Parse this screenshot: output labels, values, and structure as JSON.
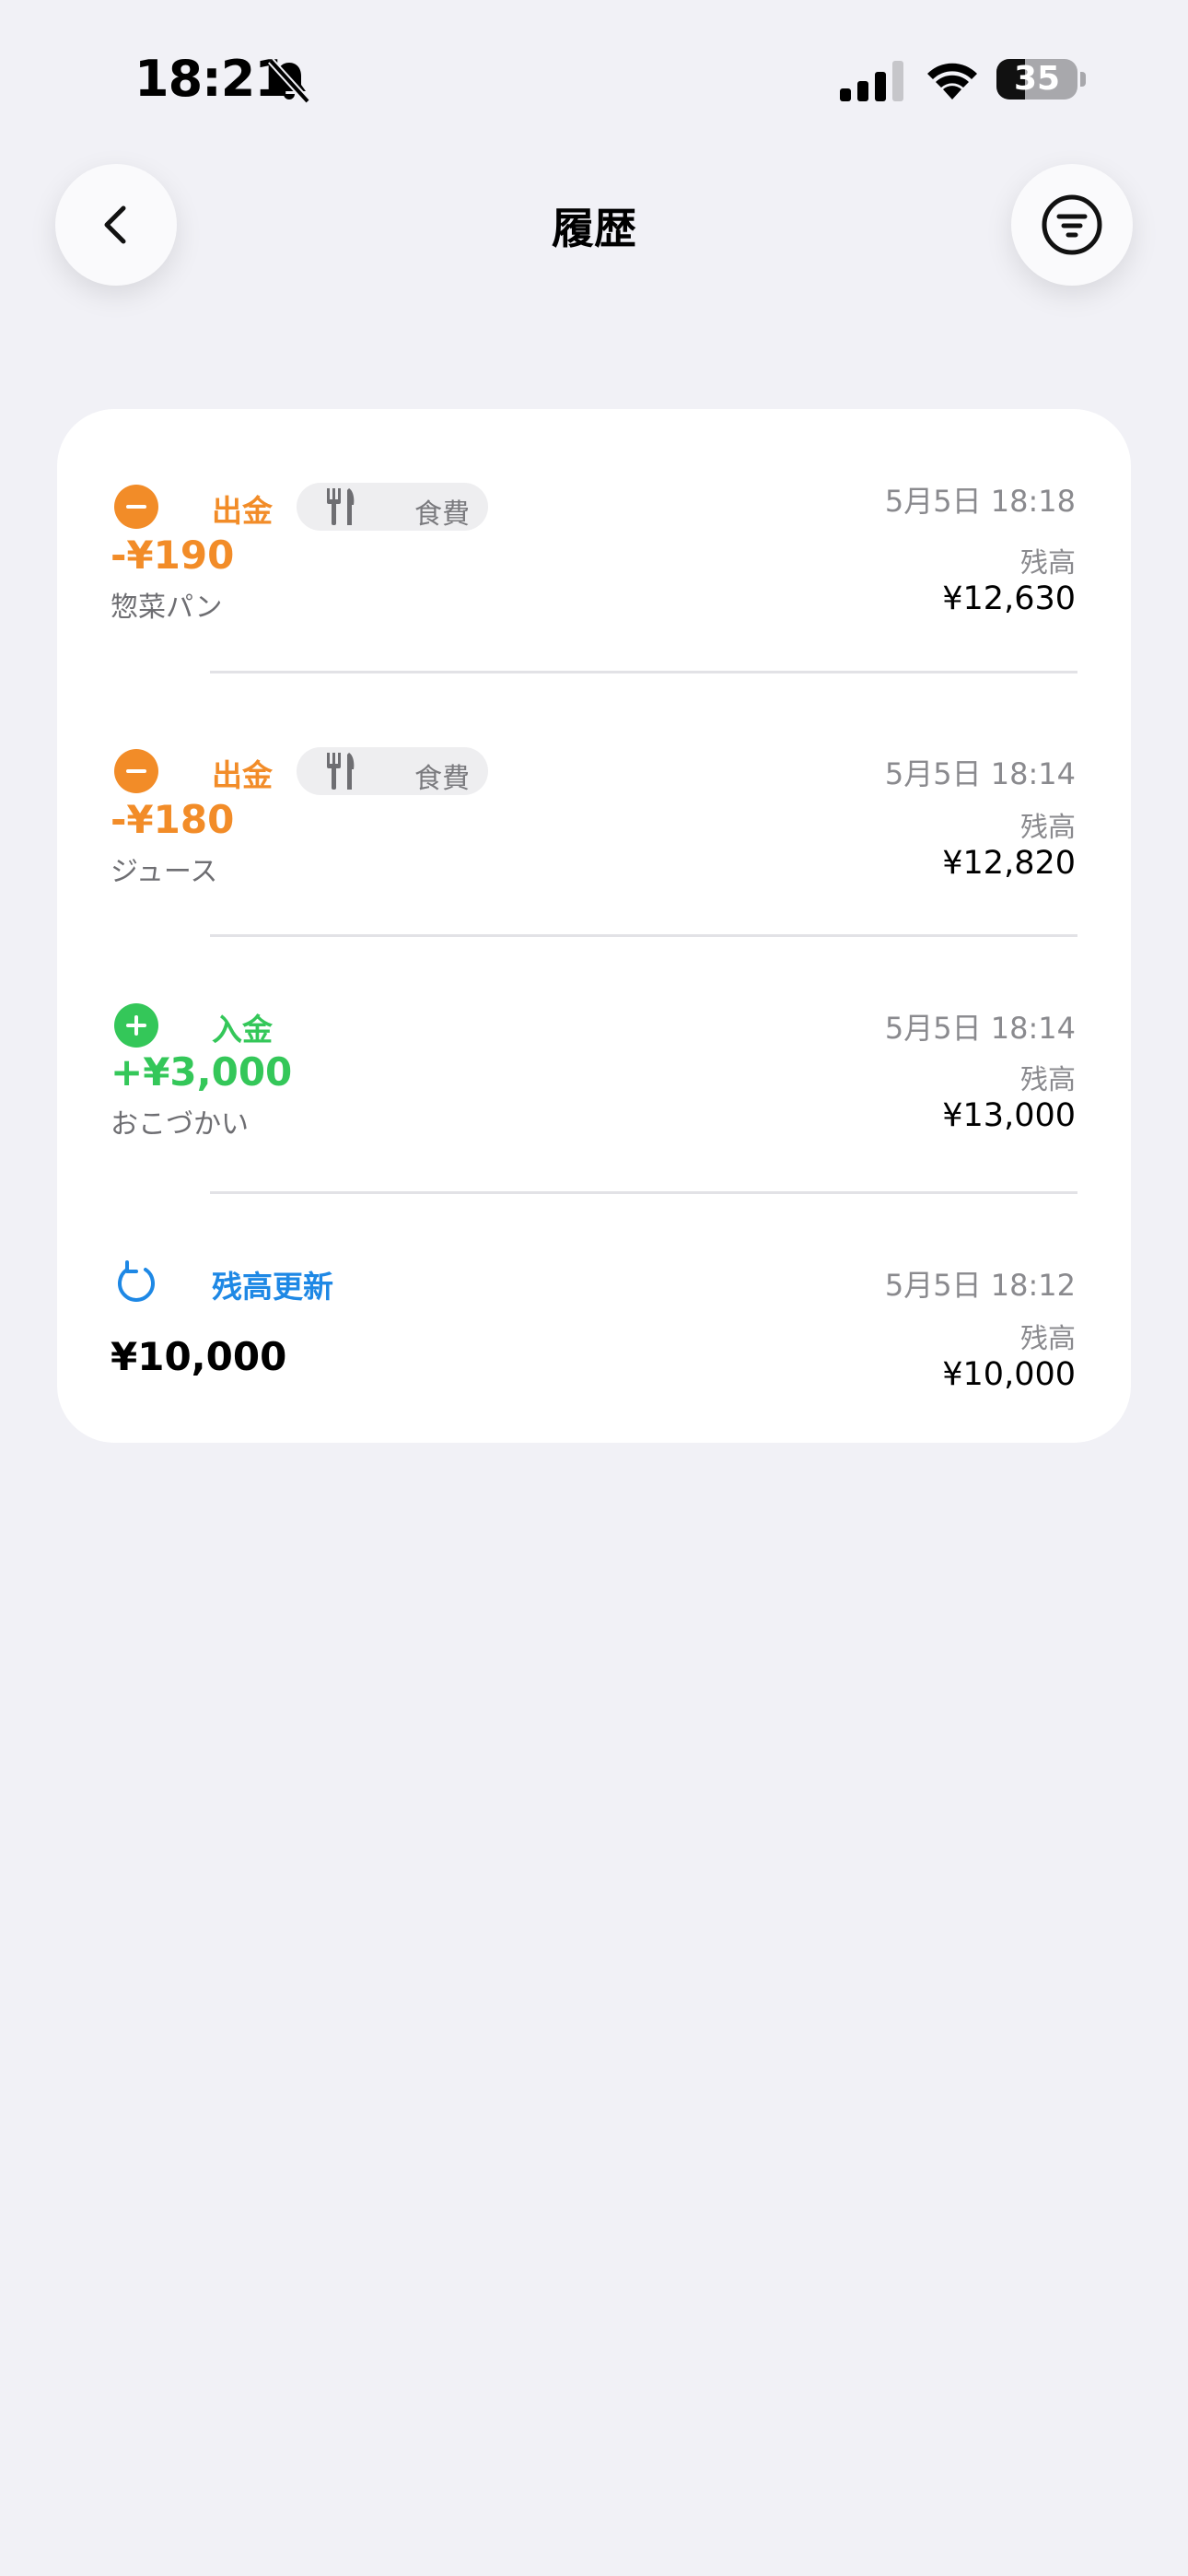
{
  "status_bar": {
    "time": "18:21",
    "battery": "35",
    "battery_level": 0.35
  },
  "nav": {
    "title": "履歴"
  },
  "entries": [
    {
      "type_label": "出金",
      "category": "食費",
      "date": "5月5日 18:18",
      "amount": "-¥190",
      "memo": "惣菜パン",
      "balance_label": "残高",
      "balance": "¥12,630"
    },
    {
      "type_label": "出金",
      "category": "食費",
      "date": "5月5日 18:14",
      "amount": "-¥180",
      "memo": "ジュース",
      "balance_label": "残高",
      "balance": "¥12,820"
    },
    {
      "type_label": "入金",
      "date": "5月5日 18:14",
      "amount": "+¥3,000",
      "memo": "おこづかい",
      "balance_label": "残高",
      "balance": "¥13,000"
    },
    {
      "type_label": "残高更新",
      "date": "5月5日 18:12",
      "amount": "¥10,000",
      "balance_label": "残高",
      "balance": "¥10,000"
    }
  ],
  "colors": {
    "withdrawal": "#F28C28",
    "deposit": "#34C759",
    "update": "#1E88E5"
  },
  "icons": {
    "withdrawal": "minus-circle-icon",
    "deposit": "plus-circle-icon",
    "update": "refresh-icon",
    "category": "fork-knife-icon",
    "back": "chevron-left-icon",
    "filter": "filter-icon"
  }
}
